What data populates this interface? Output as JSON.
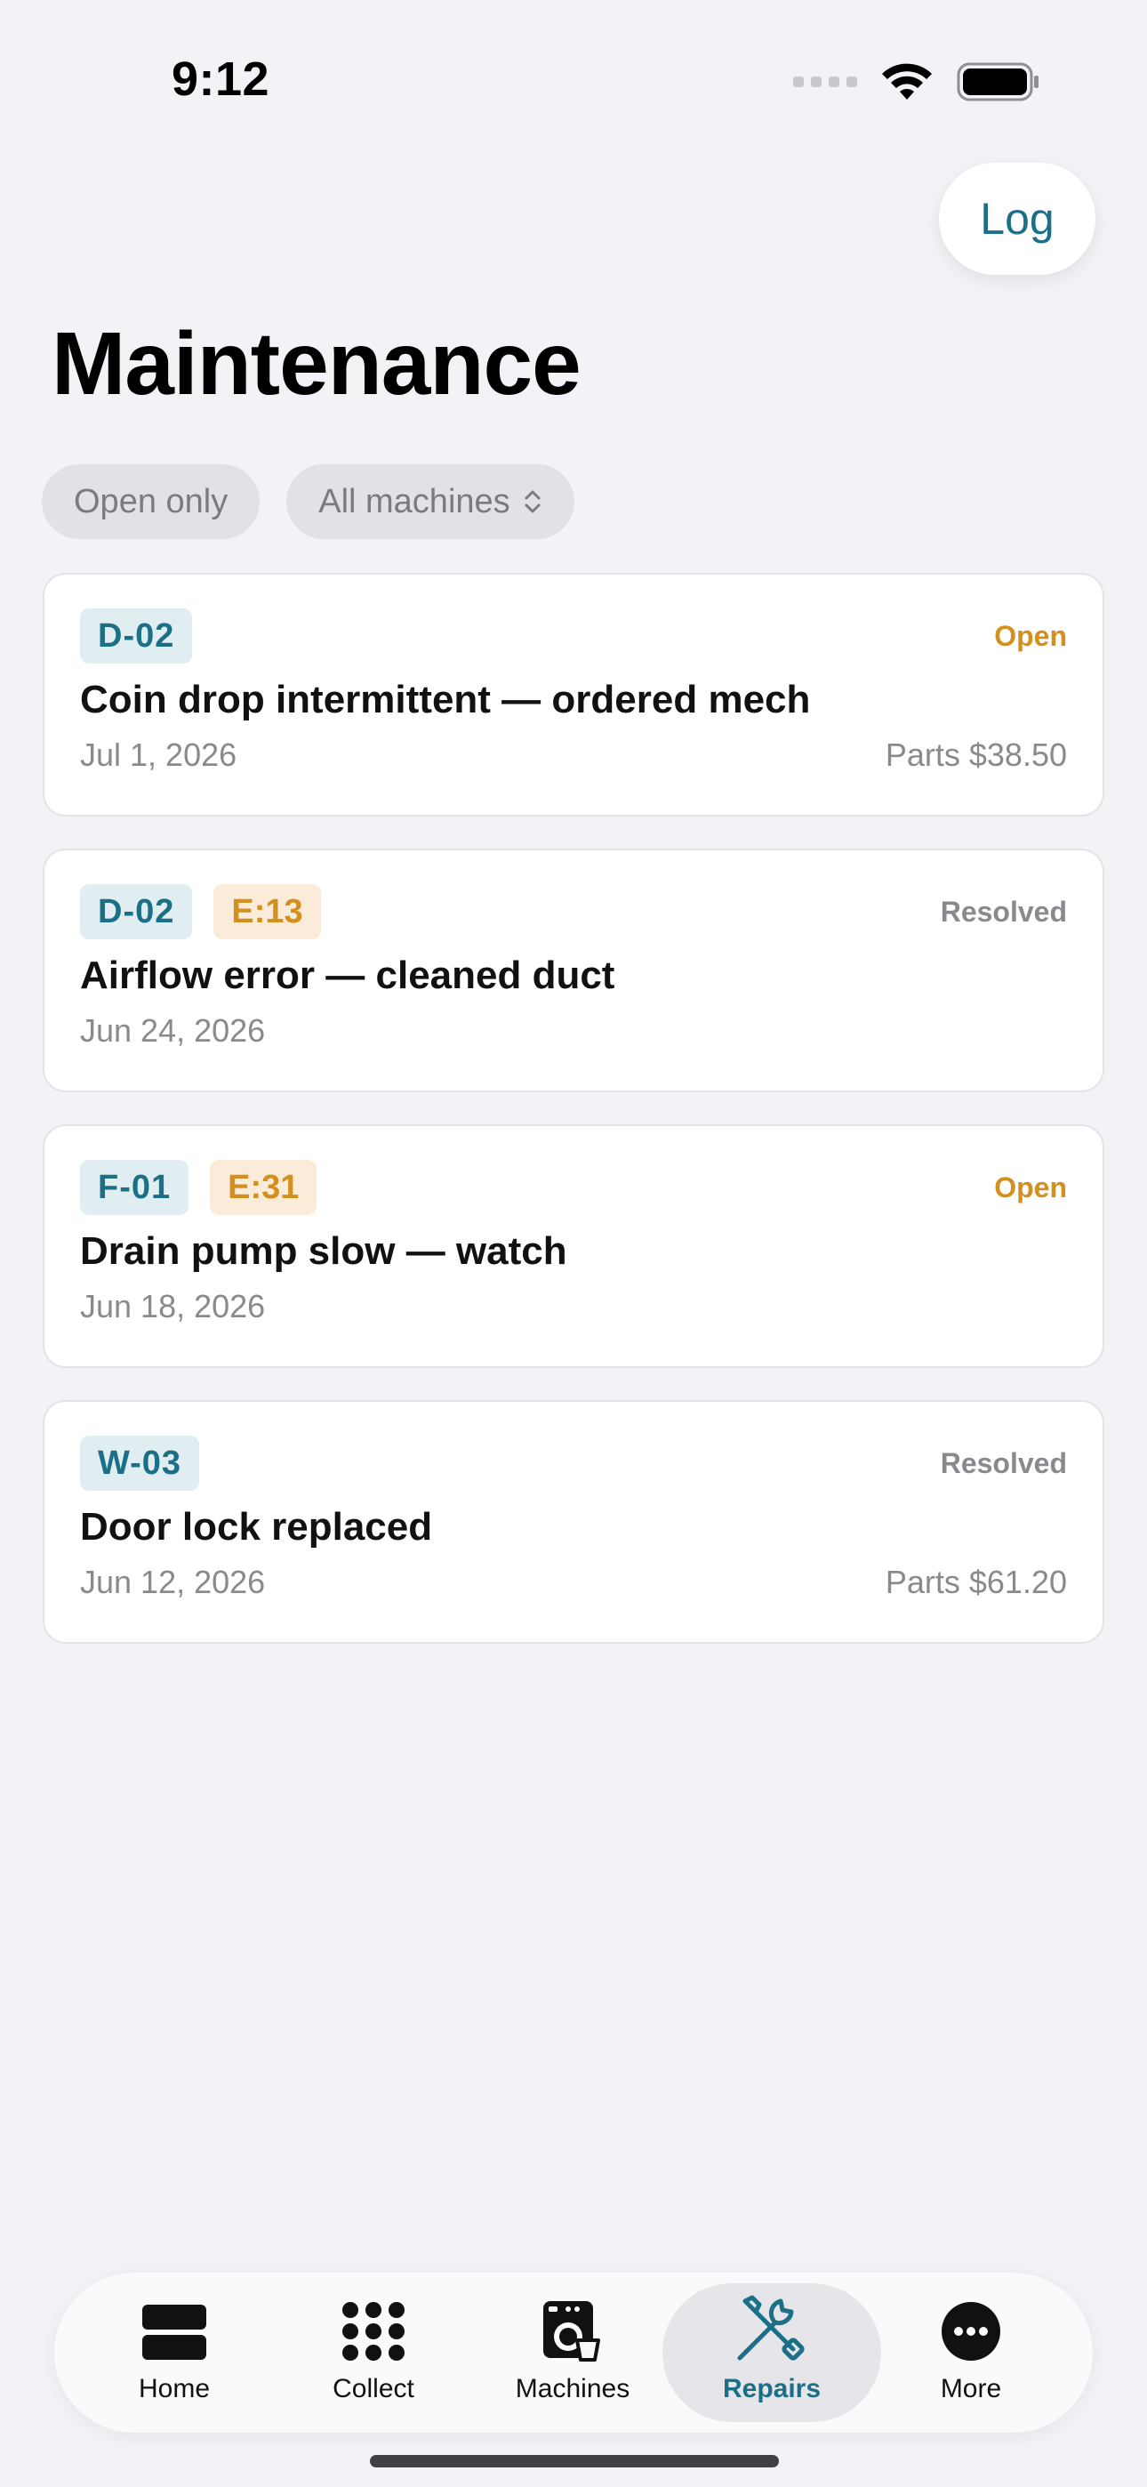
{
  "status_bar": {
    "time": "9:12"
  },
  "header": {
    "log_label": "Log",
    "title": "Maintenance"
  },
  "filters": {
    "open_only": "Open only",
    "machines": "All machines"
  },
  "records": [
    {
      "machine": "D-02",
      "error": "",
      "status": "Open",
      "title": "Coin drop intermittent — ordered mech",
      "date": "Jul 1, 2026",
      "parts": "Parts $38.50"
    },
    {
      "machine": "D-02",
      "error": "E:13",
      "status": "Resolved",
      "title": "Airflow error — cleaned duct",
      "date": "Jun 24, 2026",
      "parts": ""
    },
    {
      "machine": "F-01",
      "error": "E:31",
      "status": "Open",
      "title": "Drain pump slow — watch",
      "date": "Jun 18, 2026",
      "parts": ""
    },
    {
      "machine": "W-03",
      "error": "",
      "status": "Resolved",
      "title": "Door lock replaced",
      "date": "Jun 12, 2026",
      "parts": "Parts $61.20"
    }
  ],
  "tabs": [
    {
      "label": "Home",
      "icon": "home-icon"
    },
    {
      "label": "Collect",
      "icon": "grid-icon"
    },
    {
      "label": "Machines",
      "icon": "washer-icon"
    },
    {
      "label": "Repairs",
      "icon": "wrench-screwdriver-icon",
      "active": true
    },
    {
      "label": "More",
      "icon": "ellipsis-icon"
    }
  ],
  "colors": {
    "accent": "#1b6f86",
    "open": "#d4901f",
    "resolved": "#8a8a8e",
    "background": "#f2f2f7"
  }
}
